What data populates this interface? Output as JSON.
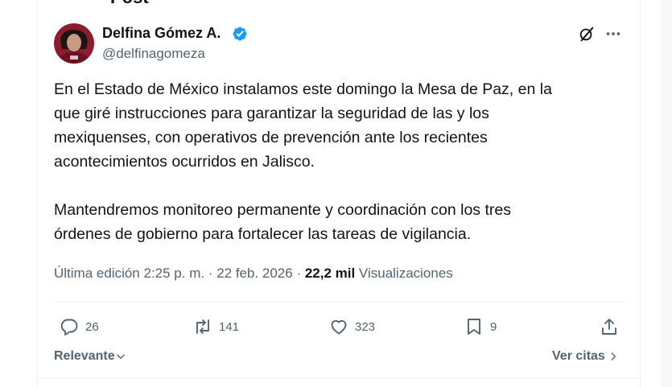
{
  "header": {
    "title": "Post"
  },
  "author": {
    "name": "Delfina Gómez A.",
    "handle": "@delfinagomeza"
  },
  "tweet": {
    "paragraph1_lines": [
      "En el Estado de México instalamos este domingo la Mesa de Paz, en la",
      "que giré instrucciones para garantizar la seguridad de las y los",
      "mexiquenses, con operativos de prevención ante los recientes",
      "acontecimientos ocurridos en Jalisco."
    ],
    "paragraph2_lines": [
      "Mantendremos monitoreo permanente y coordinación con los tres",
      "órdenes de gobierno para fortalecer las tareas de vigilancia."
    ]
  },
  "meta": {
    "edited_label": "Última edición 2:25 p. m. · 22 feb. 2026 · ",
    "views_count": "22,2 mil",
    "views_label": " Visualizaciones"
  },
  "actions": {
    "replies": "26",
    "reposts": "141",
    "likes": "323",
    "bookmarks": "9"
  },
  "footer": {
    "sort_label": "Relevante",
    "quotes_label": "Ver citas"
  },
  "colors": {
    "verified": "#1d9bf0",
    "secondary_text": "#536471",
    "primary_text": "#0f1419",
    "avatar_bg": "#8c1d2f"
  },
  "icons": {
    "verified": "verified-badge-icon",
    "grok": "grok-icon",
    "more": "more-dots-icon",
    "reply": "reply-bubble-icon",
    "repost": "repost-arrows-icon",
    "like": "heart-icon",
    "bookmark": "bookmark-icon",
    "share": "share-upload-icon"
  }
}
